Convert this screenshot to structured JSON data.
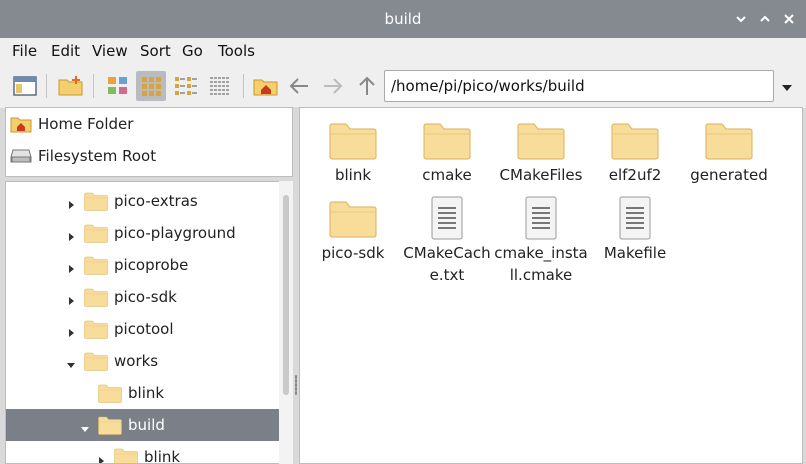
{
  "window": {
    "title": "build"
  },
  "menu": [
    {
      "id": "file",
      "label": "File"
    },
    {
      "id": "edit",
      "label": "Edit"
    },
    {
      "id": "view",
      "label": "View"
    },
    {
      "id": "sort",
      "label": "Sort"
    },
    {
      "id": "go",
      "label": "Go"
    },
    {
      "id": "tools",
      "label": "Tools"
    }
  ],
  "toolbar": {
    "path": "/home/pi/pico/works/build",
    "icons": [
      "new-window-icon",
      "new-folder-icon",
      "thumbnail-view-icon",
      "icon-view-icon",
      "compact-view-icon",
      "list-view-icon",
      "home-icon",
      "back-icon",
      "forward-icon",
      "up-icon",
      "path-dropdown-icon"
    ]
  },
  "places": [
    {
      "label": "Home Folder",
      "icon": "home-folder-icon"
    },
    {
      "label": "Filesystem Root",
      "icon": "drive-icon"
    }
  ],
  "tree": [
    {
      "label": "pico-extras",
      "expander": "collapsed",
      "level": 1
    },
    {
      "label": "pico-playground",
      "expander": "collapsed",
      "level": 1
    },
    {
      "label": "picoprobe",
      "expander": "collapsed",
      "level": 1
    },
    {
      "label": "pico-sdk",
      "expander": "collapsed",
      "level": 1
    },
    {
      "label": "picotool",
      "expander": "collapsed",
      "level": 1
    },
    {
      "label": "works",
      "expander": "expanded",
      "level": 1
    },
    {
      "label": "blink",
      "expander": "none",
      "level": 2
    },
    {
      "label": "build",
      "expander": "expanded",
      "level": 2,
      "selected": true
    },
    {
      "label": "blink",
      "expander": "collapsed",
      "level": 3
    }
  ],
  "files": [
    {
      "name": "blink",
      "type": "folder"
    },
    {
      "name": "cmake",
      "type": "folder"
    },
    {
      "name": "CMakeFiles",
      "type": "folder"
    },
    {
      "name": "elf2uf2",
      "type": "folder"
    },
    {
      "name": "generated",
      "type": "folder"
    },
    {
      "name": "pico-sdk",
      "type": "folder"
    },
    {
      "name": "CMakeCache.txt",
      "type": "file"
    },
    {
      "name": "cmake_install.cmake",
      "type": "file"
    },
    {
      "name": "Makefile",
      "type": "file"
    }
  ],
  "colors": {
    "titlebar": "#858a91",
    "selection": "#7b8088",
    "folder": "#f8dc9a"
  }
}
